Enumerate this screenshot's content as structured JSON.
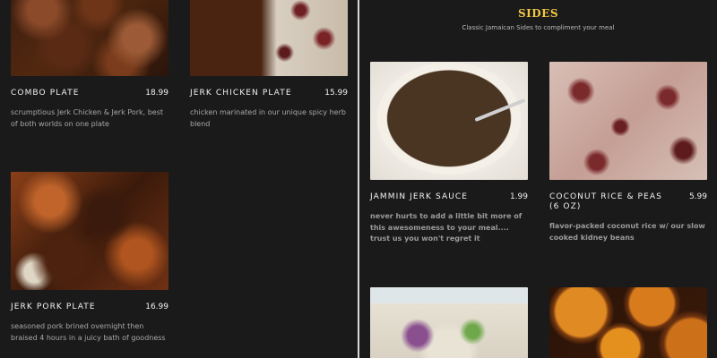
{
  "left": {
    "items": [
      {
        "name": "COMBO PLATE",
        "price": "18.99",
        "desc": "scrumptious Jerk Chicken & Jerk Pork, best of both worlds on one plate"
      },
      {
        "name": "JERK CHICKEN PLATE",
        "price": "15.99",
        "desc": "chicken marinated in our unique spicy herb blend"
      },
      {
        "name": "JERK PORK PLATE",
        "price": "16.99",
        "desc": "seasoned pork brined overnight then braised 4 hours in a juicy bath of goodness"
      }
    ]
  },
  "sides": {
    "title": "SIDES",
    "subtitle": "Classic Jamaican Sides to compliment your meal",
    "items": [
      {
        "name": "JAMMIN JERK SAUCE",
        "price": "1.99",
        "desc": "never hurts to add a little bit more of this awesomeness to your meal.... trust us you won't regret it"
      },
      {
        "name": "COCONUT RICE & PEAS (6 OZ)",
        "price": "5.99",
        "desc": "flavor-packed coconut rice w/ our slow cooked kidney beans"
      }
    ]
  },
  "colors": {
    "background": "#1a1a1a",
    "accent_title": "#f2c744",
    "divider": "#d9d9d9"
  }
}
